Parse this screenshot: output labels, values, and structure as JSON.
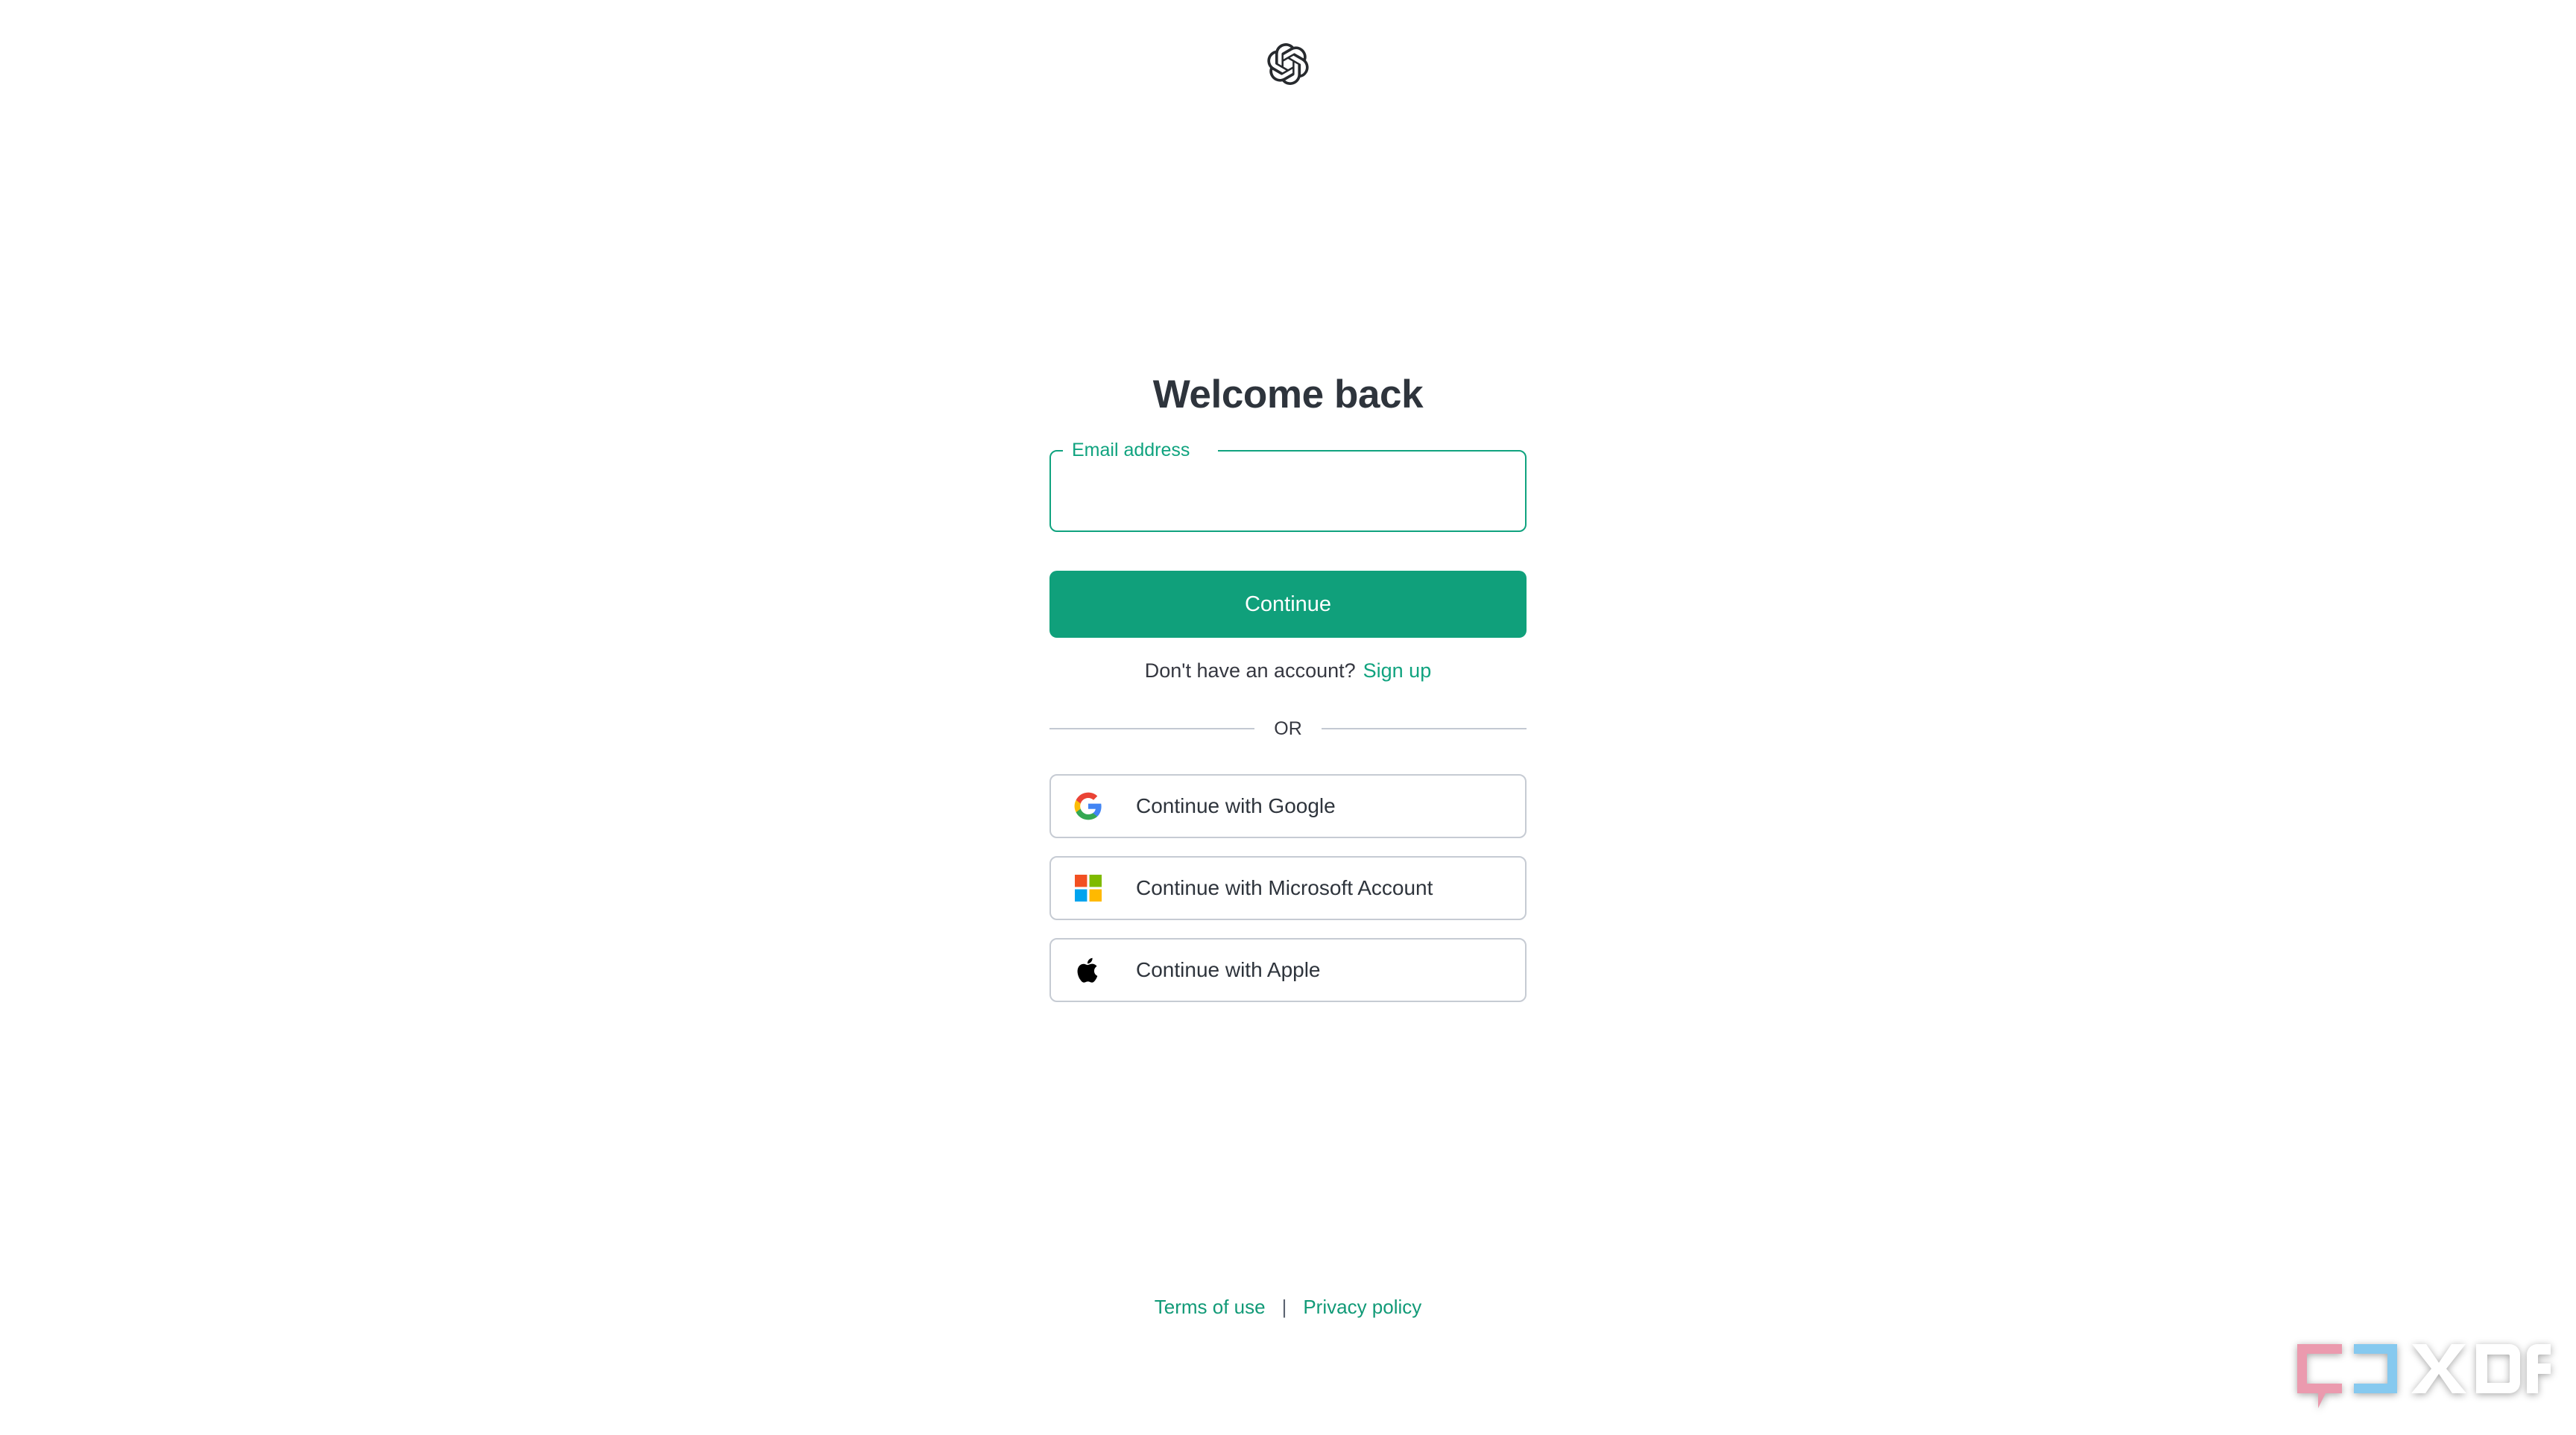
{
  "brand": {
    "logo_icon": "openai-logo-icon",
    "accent_green": "#10a37f",
    "button_green": "#10a07b",
    "text_dark": "#2e343c",
    "border_gray": "#c6cbd3"
  },
  "auth": {
    "title": "Welcome back",
    "email_field": {
      "label": "Email address",
      "value": "",
      "placeholder": ""
    },
    "continue_button": "Continue",
    "signup_prompt": "Don't have an account?",
    "signup_link": "Sign up",
    "divider_text": "OR",
    "social_buttons": [
      {
        "label": "Continue with Google",
        "icon": "google-icon"
      },
      {
        "label": "Continue with Microsoft Account",
        "icon": "microsoft-icon"
      },
      {
        "label": "Continue with Apple",
        "icon": "apple-icon"
      }
    ]
  },
  "footer": {
    "terms_link": "Terms of use",
    "separator": "|",
    "privacy_link": "Privacy policy"
  },
  "watermark": {
    "text": "XDA",
    "bracket_left_color": "#eb9aae",
    "bracket_right_color": "#86c9ef",
    "text_color": "#ffffff"
  }
}
